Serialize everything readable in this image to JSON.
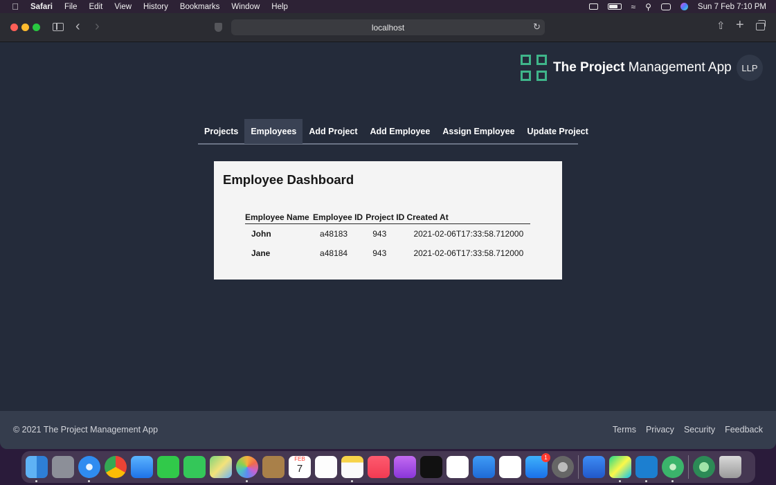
{
  "menubar": {
    "app_name": "Safari",
    "items": [
      "File",
      "Edit",
      "View",
      "History",
      "Bookmarks",
      "Window",
      "Help"
    ],
    "datetime": "Sun 7 Feb  7:10 PM"
  },
  "browser": {
    "url": "localhost"
  },
  "header": {
    "brand_bold": "The Project",
    "brand_rest": " Management App",
    "avatar_initials": "LLP"
  },
  "nav": {
    "tabs": [
      {
        "label": "Projects"
      },
      {
        "label": "Employees"
      },
      {
        "label": "Add Project"
      },
      {
        "label": "Add Employee"
      },
      {
        "label": "Assign Employee"
      },
      {
        "label": "Update Project"
      }
    ],
    "active": "Employees"
  },
  "dashboard": {
    "title": "Employee Dashboard",
    "columns": [
      "Employee Name",
      "Employee ID",
      "Project ID",
      "Created At"
    ],
    "rows": [
      {
        "name": "John",
        "employee_id": "a48183",
        "project_id": "943",
        "created_at": "2021-02-06T17:33:58.712000"
      },
      {
        "name": "Jane",
        "employee_id": "a48184",
        "project_id": "943",
        "created_at": "2021-02-06T17:33:58.712000"
      }
    ]
  },
  "footer": {
    "copyright": "© 2021 The Project Management App",
    "links": [
      "Terms",
      "Privacy",
      "Security",
      "Feedback"
    ]
  },
  "dock": {
    "mail_badge": "1",
    "calendar_month": "FEB",
    "calendar_day": "7"
  },
  "colors": {
    "page_bg": "#242b3a",
    "footer_bg": "#353d4d",
    "brand_green": "#3fb58a",
    "active_tab": "#3a4254",
    "card_bg": "#f4f4f4"
  }
}
